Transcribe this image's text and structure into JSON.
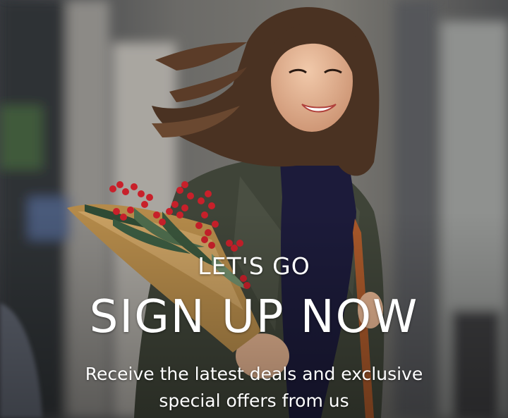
{
  "hero": {
    "eyebrow": "LET'S GO",
    "headline": "SIGN UP NOW",
    "subtext_line1": "Receive the latest deals and exclusive",
    "subtext_line2": "special offers from us",
    "image_subject": "smiling woman with windswept brown hair carrying a bouquet of red berries and greenery in kraft paper on a blurred city street",
    "colors": {
      "text": "#ffffff",
      "coat": "#3f4438",
      "scarf": "#1c1b3a",
      "berries": "#c8202a",
      "wrap": "#b48a4a",
      "strap": "#a8582a"
    }
  }
}
